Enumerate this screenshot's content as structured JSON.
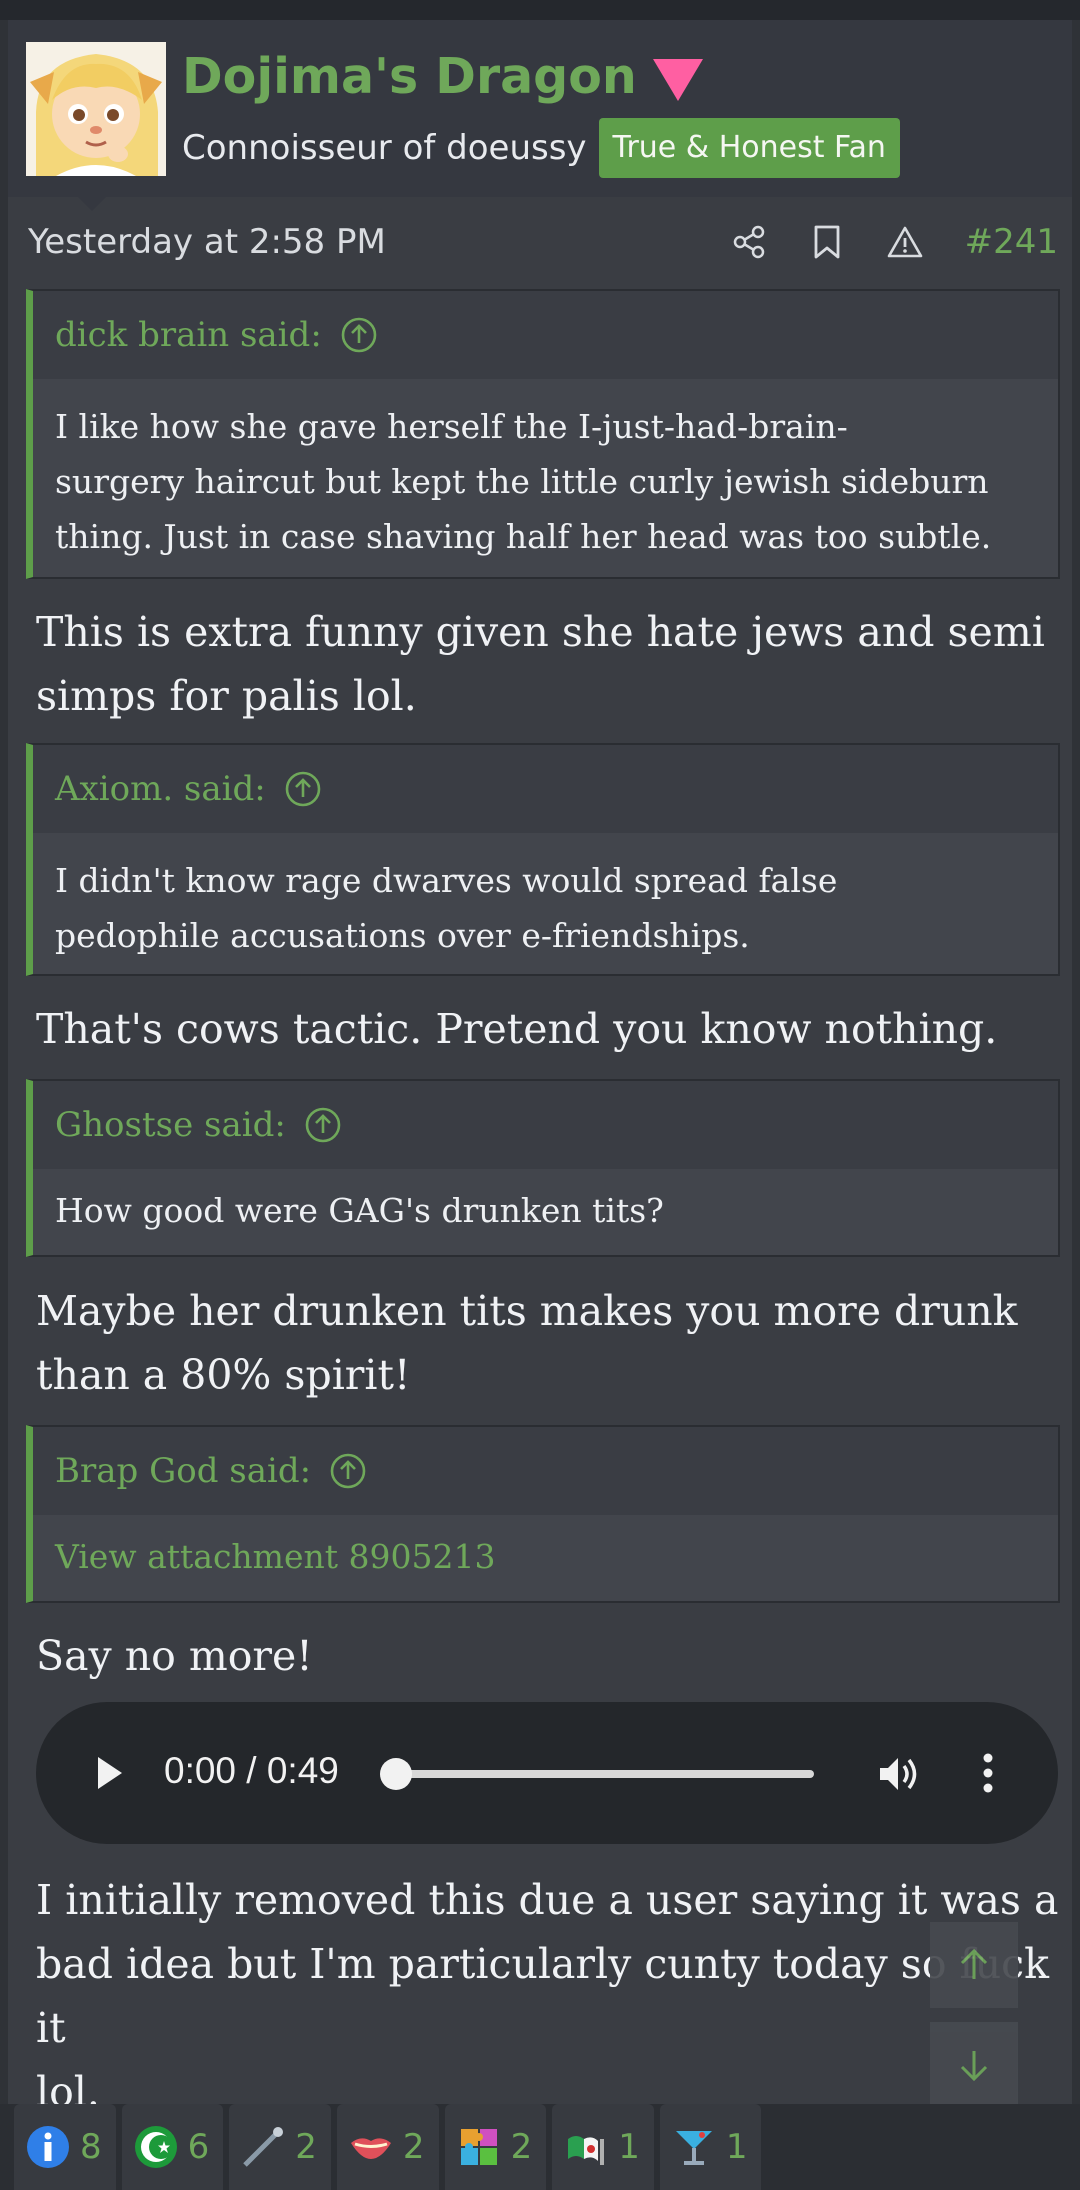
{
  "user": {
    "name": "Dojima's Dragon",
    "title": "Connoisseur of doeussy",
    "badge": "True & Honest Fan"
  },
  "post_meta": {
    "date": "Yesterday at 2:58 PM",
    "post_number": "#241",
    "actions": [
      "share-icon",
      "bookmark-icon",
      "report-icon"
    ]
  },
  "content": {
    "quote1": {
      "author": "dick brain said:",
      "lines": [
        "I like how she gave herself the I-just-had-brain-",
        "surgery haircut but kept the little curly jewish sideburn",
        "thing. Just in case shaving half her head was too subtle."
      ]
    },
    "reply1": [
      "This is extra funny given she hate jews and semi",
      "simps for palis lol."
    ],
    "quote2": {
      "author": "Axiom. said:",
      "lines": [
        "I didn't know rage dwarves would spread false",
        "pedophile accusations over e-friendships."
      ]
    },
    "reply2": "That's cows tactic. Pretend you know nothing.",
    "quote3": {
      "author": "Ghostse said:",
      "lines": [
        "How good were GAG's drunken tits?"
      ]
    },
    "reply3": [
      "Maybe her drunken tits makes you more drunk",
      "than a 80% spirit!"
    ],
    "quote4": {
      "author": "Brap God said:",
      "attachment": "View attachment 8905213"
    },
    "reply4": "Say no more!",
    "audio": {
      "time": "0:00 / 0:49",
      "progress": 0
    },
    "reply5": [
      "I initially removed this due a user saying it was a",
      "bad idea but I'm particularly cunty today so fuck it",
      "lol."
    ]
  },
  "reactions": [
    {
      "icon": "informative-icon",
      "count": "8",
      "color": "#2f7fe8"
    },
    {
      "icon": "islamic-content-icon",
      "count": "6",
      "color": "#1d9a3a"
    },
    {
      "icon": "needle-icon",
      "count": "2",
      "color": "#8a9aa8"
    },
    {
      "icon": "lips-icon",
      "count": "2",
      "color": "#e0505a"
    },
    {
      "icon": "puzzle-icon",
      "count": "2",
      "color": "#e8a030"
    },
    {
      "icon": "flag-icon",
      "count": "1",
      "color": "#2aa050"
    },
    {
      "icon": "cocktail-icon",
      "count": "1",
      "color": "#3ab0e0"
    }
  ],
  "colors": {
    "accent": "#6fa85a",
    "background": "#3a3d43",
    "badge": "#5e9e4a",
    "triangle": "#ff5fa2"
  }
}
